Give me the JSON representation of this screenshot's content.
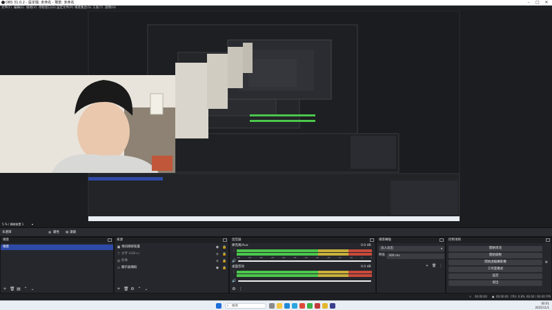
{
  "window": {
    "title": "OBS 31.0.2 - 設定檔: 未命名 - 場景: 未命名"
  },
  "menu": [
    "文件(F)",
    "編輯(E)",
    "檢視(V)",
    "停駐窗口(D)",
    "設定文件(P)",
    "場景集合(S)",
    "工具(T)",
    "說明(H)"
  ],
  "preview_info": {
    "source_label": "5.% / 擷取裝置 1"
  },
  "toolbar": {
    "selected_source": "未選擇",
    "properties": "屬性",
    "filters": "濾鏡"
  },
  "scenes": {
    "title": "場景",
    "items": [
      "場景"
    ],
    "selected": 0
  },
  "sources": {
    "title": "來源",
    "items": [
      "視訊擷取裝置",
      "文字 (GDI+)",
      "影像",
      "顯示器擷取"
    ]
  },
  "mixer": {
    "title": "混音器",
    "channels": [
      {
        "name": "麥克風/Aux",
        "level": "0.0 dB"
      },
      {
        "name": "桌面音效",
        "level": "0.0 dB"
      }
    ],
    "ticks": [
      "-60",
      "-55",
      "-50",
      "-45",
      "-40",
      "-35",
      "-30",
      "-25",
      "-20",
      "-15",
      "-10",
      "-5",
      "0"
    ]
  },
  "transitions": {
    "title": "場景轉換",
    "type": "淡入淡出",
    "duration_label": "時長",
    "duration": "300 ms"
  },
  "controls": {
    "title": "控制項目",
    "buttons": [
      "開始串流",
      "開始錄製",
      "開始虛擬攝影機",
      "工作室模式",
      "設定",
      "退出"
    ]
  },
  "status": {
    "stream_time": "00:00:00",
    "rec_time": "00:00:00",
    "cpu": "CPU: 0.8%",
    "fps": "60.00 / 60.00 FPS"
  },
  "taskbar": {
    "search_placeholder": "搜尋",
    "time": "00:01",
    "date": "2025/11/1"
  },
  "colors": {
    "accent": "#2e4aa8",
    "meter_green": "#4cc74c",
    "meter_yellow": "#c9b03a",
    "meter_red": "#c94a3a"
  }
}
